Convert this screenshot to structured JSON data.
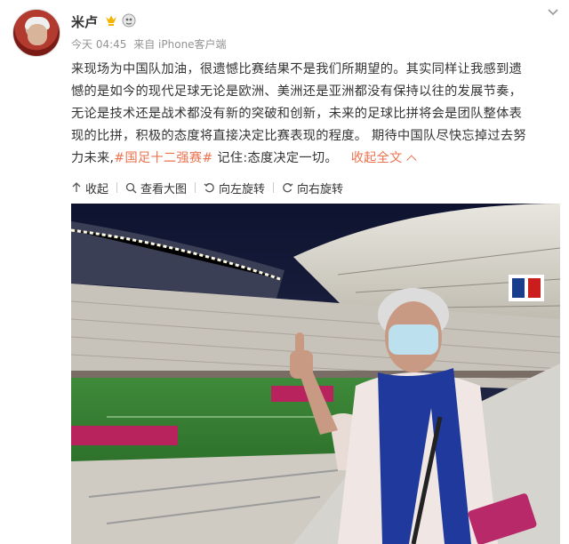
{
  "user": {
    "name": "米卢",
    "avatar_icon": "user-avatar",
    "badges": [
      "vip-crown-icon",
      "level-badge-icon"
    ]
  },
  "meta": {
    "time": "今天 04:45",
    "source": "来自 iPhone客户端"
  },
  "post": {
    "lines": [
      "来现场为中国队加油，很遗憾比赛结果不是我们所期望的。其实同样让我感到遗",
      "憾的是如今的现代足球无论是欧洲、美洲还是亚洲都没有保持以往的发展节奏，",
      "无论是技术还是战术都没有新的突破和创新，未来的足球比拼将会是团队整体表",
      "现的比拼，积极的态度将直接决定比赛表现的程度。 期待中国队尽快忘掉过去努"
    ],
    "last_line_prefix": "力未来,",
    "hashtag": "#国足十二强赛#",
    "last_line_suffix": " 记住:态度决定一切。",
    "collapse_label": "收起全文"
  },
  "toolbar": {
    "collapse": "收起",
    "view_large": "查看大图",
    "rotate_left": "向左旋转",
    "rotate_right": "向右旋转"
  },
  "colors": {
    "link": "#eb7350",
    "meta": "#939393",
    "text": "#333333"
  }
}
